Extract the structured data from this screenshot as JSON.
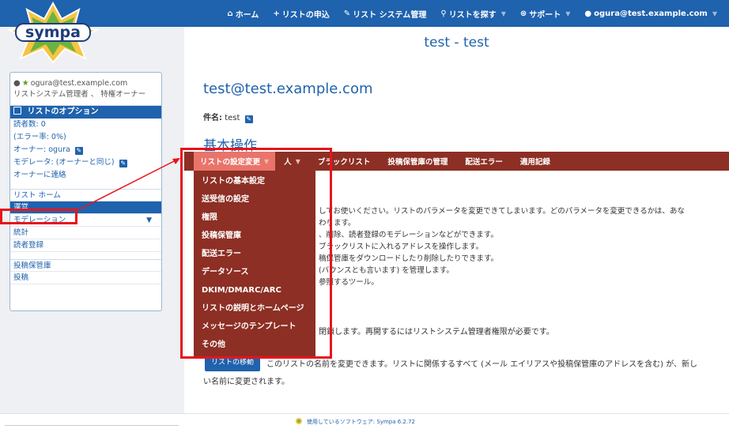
{
  "topnav": {
    "items": [
      {
        "icon": "home-icon",
        "glyph": "⌂",
        "label": "ホーム"
      },
      {
        "icon": "plus-icon",
        "glyph": "+",
        "label": "リストの申込"
      },
      {
        "icon": "wrench-icon",
        "glyph": "✎",
        "label": "リスト システム管理"
      },
      {
        "icon": "search-icon",
        "glyph": "⚲",
        "label": "リストを探す"
      },
      {
        "icon": "support-icon",
        "glyph": "⊛",
        "label": "サポート"
      },
      {
        "icon": "user-icon",
        "glyph": "👤",
        "label": "ogura@test.example.com"
      }
    ]
  },
  "logo": {
    "text": "sympa"
  },
  "main": {
    "page_title": "test - test",
    "list_address": "test@test.example.com",
    "subject_label": "件名:",
    "subject_value": "test",
    "section_title": "基本操作"
  },
  "menubar": {
    "items": [
      "リストの設定変更",
      "人",
      "ブラックリスト",
      "投稿保管庫の管理",
      "配送エラー",
      "適用記録"
    ]
  },
  "dropdown": {
    "items": [
      "リストの基本設定",
      "送受信の設定",
      "権限",
      "投稿保管庫",
      "配送エラー",
      "データソース",
      "DKIM/DMARC/ARC",
      "リストの説明とホームページ",
      "メッセージのテンプレート",
      "その他"
    ]
  },
  "body_lines": [
    "してお使いください。リストのパラメータを変更できてしまいます。どのパラメータを変更できるかは、あな",
    "わります。",
    "、削除、読者登録のモデレーションなどができます。",
    "ブラックリストに入れるアドレスを操作します。",
    "稿保管庫をダウンロードしたり削除したりできます。",
    "(バウンスとも言います) を管理します。",
    "参照するツール。"
  ],
  "close_note": "閉鎖します。再開するにはリストシステム管理者権限が必要です。",
  "rename": {
    "button": "リストの移動",
    "desc": "このリストの名前を変更できます。リストに関係するすべて (メール エイリアスや投稿保管庫のアドレスを含む) が、新し",
    "desc2": "い名前に変更されます。"
  },
  "sidebar": {
    "user_email": "ogura@test.example.com",
    "user_role": "リストシステム管理者 、 特権オーナー",
    "options_title": "リストのオプション",
    "stats": {
      "subscribers": "読者数: 0",
      "errors": "(エラー率: 0%)",
      "owner": "オーナー: ogura",
      "moderator": "モデレータ: (オーナーと同じ)",
      "contact_owner": "オーナーに連絡"
    },
    "nav": [
      "リスト ホーム",
      "運営",
      "モデレーション",
      "統計",
      "読者登録"
    ],
    "nav2": [
      "投稿保管庫",
      "投稿"
    ]
  },
  "footer": {
    "text": "使用しているソフトウェア: Sympa 6.2.72"
  },
  "colors": {
    "brand": "#1f62ad",
    "menu_bar": "#8d2f24",
    "menu_active": "#e9746a",
    "annotation": "#e8141c"
  }
}
